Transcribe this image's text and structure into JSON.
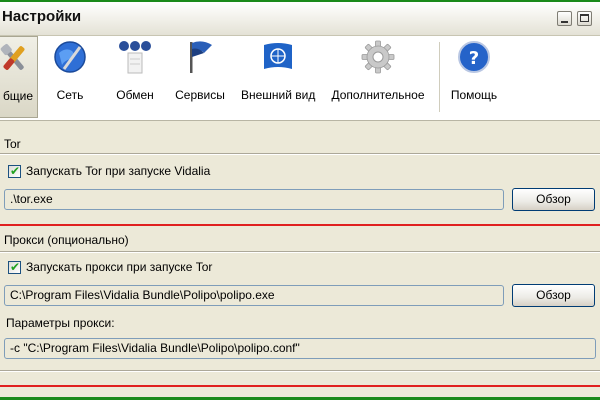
{
  "window": {
    "title": "Настройки"
  },
  "toolbar": {
    "items": [
      {
        "label": "бщие",
        "icon": "tools-icon"
      },
      {
        "label": "Сеть",
        "icon": "globe-icon"
      },
      {
        "label": "Обмен",
        "icon": "share-icon"
      },
      {
        "label": "Сервисы",
        "icon": "flag-icon"
      },
      {
        "label": "Внешний вид",
        "icon": "un-flag-icon"
      },
      {
        "label": "Дополнительное",
        "icon": "gear-icon"
      },
      {
        "label": "Помощь",
        "icon": "help-icon"
      }
    ]
  },
  "tor": {
    "group_label": "Tor",
    "start_checkbox_label": "Запускать Tor при запуске Vidalia",
    "path_value": ".\\tor.exe",
    "browse_label": "Обзор"
  },
  "proxy": {
    "group_label": "Прокси (опционально)",
    "start_checkbox_label": "Запускать прокси при запуске Tor",
    "path_value": "C:\\Program Files\\Vidalia Bundle\\Polipo\\polipo.exe",
    "browse_label": "Обзор",
    "params_label": "Параметры прокси:",
    "params_value": "-c \"C:\\Program Files\\Vidalia Bundle\\Polipo\\polipo.conf\""
  },
  "colors": {
    "annotation_green": "#1a8a1a",
    "annotation_red": "#e02020",
    "window_bg": "#ece9d8"
  }
}
